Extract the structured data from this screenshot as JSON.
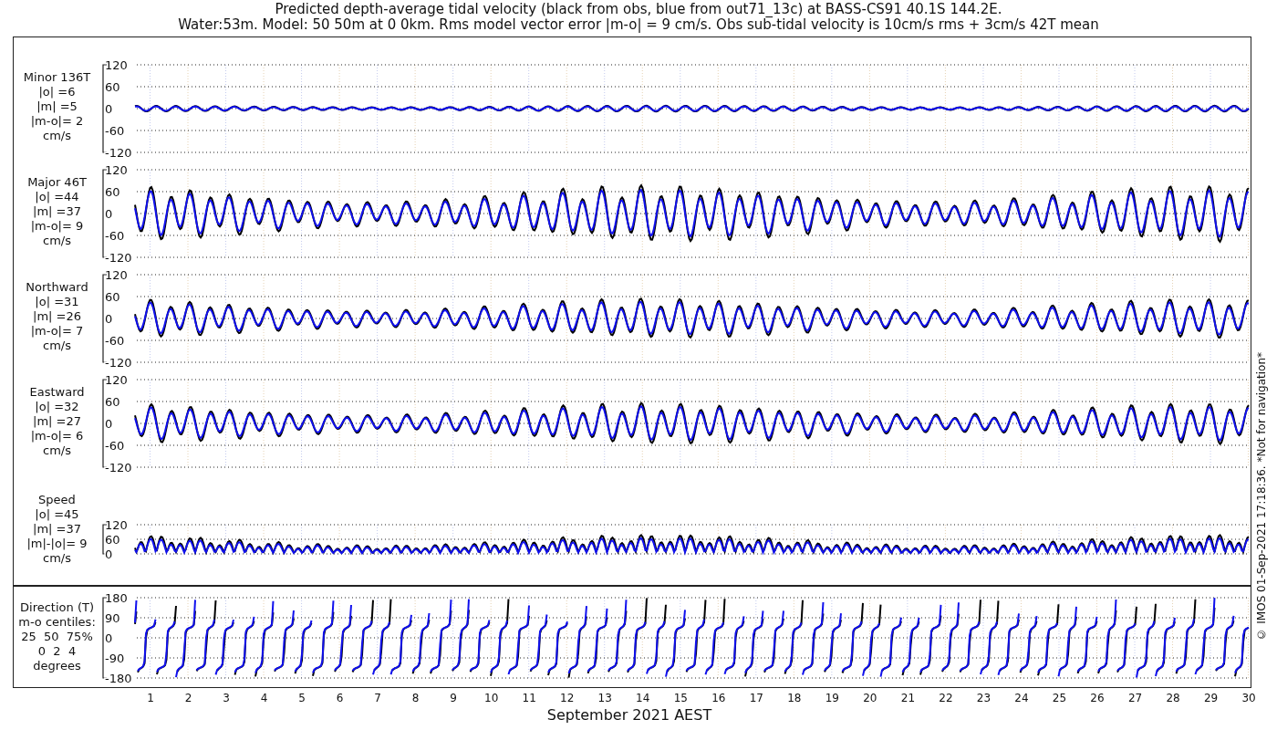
{
  "title_lines": [
    "Predicted depth-average tidal velocity (black from obs, blue from out71_13c) at BASS-CS91 40.1S 144.2E.",
    "Water:53m. Model: 50 50m at 0 0km. Rms model vector error |m-o| = 9 cm/s. Obs sub-tidal velocity is 10cm/s rms + 3cm/s 42T mean"
  ],
  "panels": [
    {
      "kind": "minor",
      "label_lines": [
        "Minor 136T",
        "|o| =6",
        "|m| =5",
        "|m-o|= 2",
        "cm/s"
      ],
      "yticks": [
        "120",
        "60",
        "0",
        "-60",
        "-120"
      ]
    },
    {
      "kind": "major",
      "label_lines": [
        "Major 46T",
        "|o| =44",
        "|m| =37",
        "|m-o|= 9",
        "cm/s"
      ],
      "yticks": [
        "120",
        "60",
        "0",
        "-60",
        "-120"
      ]
    },
    {
      "kind": "north",
      "label_lines": [
        "Northward",
        "|o| =31",
        "|m| =26",
        "|m-o|= 7",
        "cm/s"
      ],
      "yticks": [
        "120",
        "60",
        "0",
        "-60",
        "-120"
      ]
    },
    {
      "kind": "east",
      "label_lines": [
        "Eastward",
        "|o| =32",
        "|m| =27",
        "|m-o|= 6",
        "cm/s"
      ],
      "yticks": [
        "120",
        "60",
        "0",
        "-60",
        "-120"
      ]
    },
    {
      "kind": "speed",
      "label_lines": [
        "Speed",
        "|o| =45",
        "|m| =37",
        "|m|-|o|= 9",
        "cm/s"
      ],
      "yticks": [
        "120",
        "60",
        "0"
      ]
    },
    {
      "kind": "direction",
      "label_lines": [
        "Direction (T)",
        "m-o centiles:",
        "25  50  75%",
        "0  2  4",
        "degrees"
      ],
      "yticks": [
        "180",
        "90",
        "0",
        "-90",
        "-180"
      ]
    }
  ],
  "x_ticks": [
    "1",
    "2",
    "3",
    "4",
    "5",
    "6",
    "7",
    "8",
    "9",
    "10",
    "11",
    "12",
    "13",
    "14",
    "15",
    "16",
    "17",
    "18",
    "19",
    "20",
    "21",
    "22",
    "23",
    "24",
    "25",
    "26",
    "27",
    "28",
    "29",
    "30"
  ],
  "xlabel": "September 2021 AEST",
  "credit": "© IMOS 01-Sep-2021 17:18:36. *Not for navigation*"
}
